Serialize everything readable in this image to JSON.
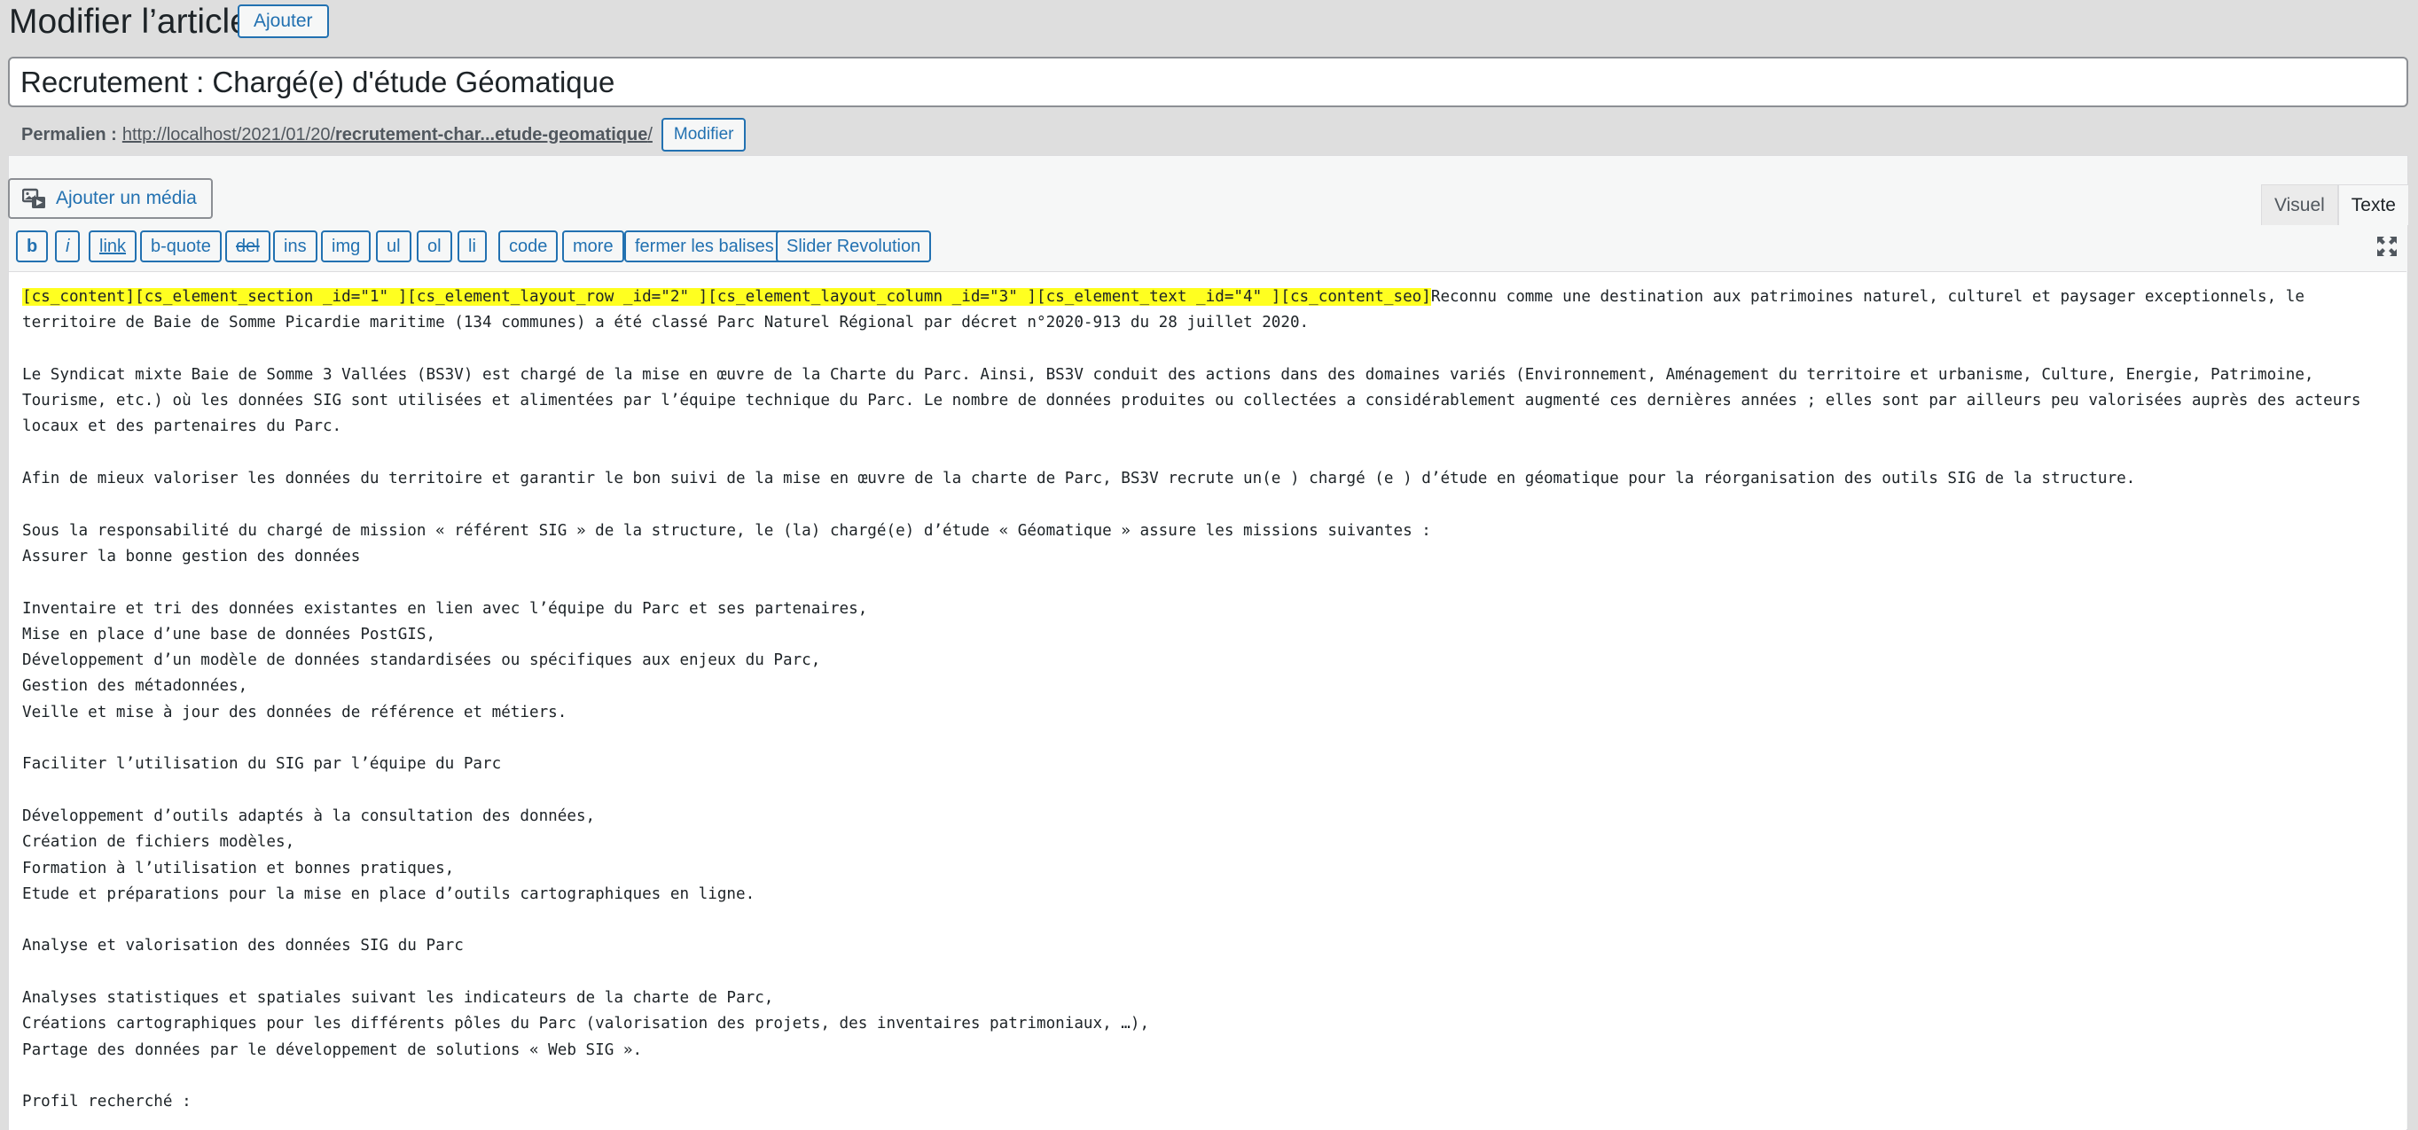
{
  "header": {
    "title": "Modifier l’article",
    "add_button": "Ajouter"
  },
  "post": {
    "title_value": "Recrutement : Chargé(e) d'étude Géomatique"
  },
  "permalink": {
    "label": "Permalien :",
    "url_prefix": "http://localhost/2021/01/20/",
    "url_slug": "recrutement-char...etude-geomatique",
    "url_suffix": "/",
    "edit_button": "Modifier"
  },
  "media": {
    "button_label": "Ajouter un média",
    "icon": "media-icon"
  },
  "editor_tabs": [
    {
      "label": "Visuel",
      "active": false
    },
    {
      "label": "Texte",
      "active": true
    }
  ],
  "quicktags": [
    {
      "label": "b"
    },
    {
      "label": "i"
    },
    {
      "label": "link"
    },
    {
      "label": "b-quote"
    },
    {
      "label": "del"
    },
    {
      "label": "ins"
    },
    {
      "label": "img"
    },
    {
      "label": "ul"
    },
    {
      "label": "ol"
    },
    {
      "label": "li"
    },
    {
      "label": "code"
    },
    {
      "label": "more"
    },
    {
      "label": "fermer les balises"
    },
    {
      "label": "Slider Revolution"
    }
  ],
  "fullscreen_icon": "fullscreen-icon",
  "highlight_color": "#ffff20",
  "content": {
    "highlighted_shortcodes": "[cs_content][cs_element_section _id=\"1\" ][cs_element_layout_row _id=\"2\" ][cs_element_layout_column _id=\"3\" ][cs_element_text _id=\"4\" ][cs_content_seo]",
    "first_line_rest": "Reconnu comme une destination aux patrimoines naturel, culturel et paysager exceptionnels, le",
    "line2": "territoire de Baie de Somme Picardie maritime (134 communes) a été classé Parc Naturel Régional par décret n°2020-913 du 28 juillet 2020.",
    "p2_l1": "Le Syndicat mixte Baie de Somme 3 Vallées (BS3V) est chargé de la mise en œuvre de la Charte du Parc. Ainsi, BS3V conduit des actions dans des domaines variés (Environnement, Aménagement du territoire et urbanisme, Culture, Energie, Patrimoine,",
    "p2_l2": "Tourisme, etc.) où les données SIG sont utilisées et alimentées par l’équipe technique du Parc. Le nombre de données produites ou collectées a considérablement augmenté ces dernières années ; elles sont par ailleurs peu valorisées auprès des acteurs",
    "p2_l3": "locaux et des partenaires du Parc.",
    "p3_l1": "Afin de mieux valoriser les données du territoire et garantir le bon suivi de la mise en œuvre de la charte de Parc, BS3V recrute un(e ) chargé (e ) d’étude en géomatique pour la réorganisation des outils SIG de la structure.",
    "p4_l1": "Sous la responsabilité du chargé de mission « référent SIG » de la structure, le (la) chargé(e) d’étude « Géomatique » assure les missions suivantes :",
    "p4_l2": "Assurer la bonne gestion des données",
    "p5_l1": "Inventaire et tri des données existantes en lien avec l’équipe du Parc et ses partenaires,",
    "p5_l2": "Mise en place d’une base de données PostGIS,",
    "p5_l3": "Développement d’un modèle de données standardisées ou spécifiques aux enjeux du Parc,",
    "p5_l4": "Gestion des métadonnées,",
    "p5_l5": "Veille et mise à jour des données de référence et métiers.",
    "p6_l1": "Faciliter l’utilisation du SIG par l’équipe du Parc",
    "p7_l1": "Développement d’outils adaptés à la consultation des données,",
    "p7_l2": "Création de fichiers modèles,",
    "p7_l3": "Formation à l’utilisation et bonnes pratiques,",
    "p7_l4": "Etude et préparations pour la mise en place d’outils cartographiques en ligne.",
    "p8_l1": "Analyse et valorisation des données SIG du Parc",
    "p9_l1": "Analyses statistiques et spatiales suivant les indicateurs de la charte de Parc,",
    "p9_l2": "Créations cartographiques pour les différents pôles du Parc (valorisation des projets, des inventaires patrimoniaux, …),",
    "p9_l3": "Partage des données par le développement de solutions « Web SIG ».",
    "p10_l1": "Profil recherché :"
  }
}
